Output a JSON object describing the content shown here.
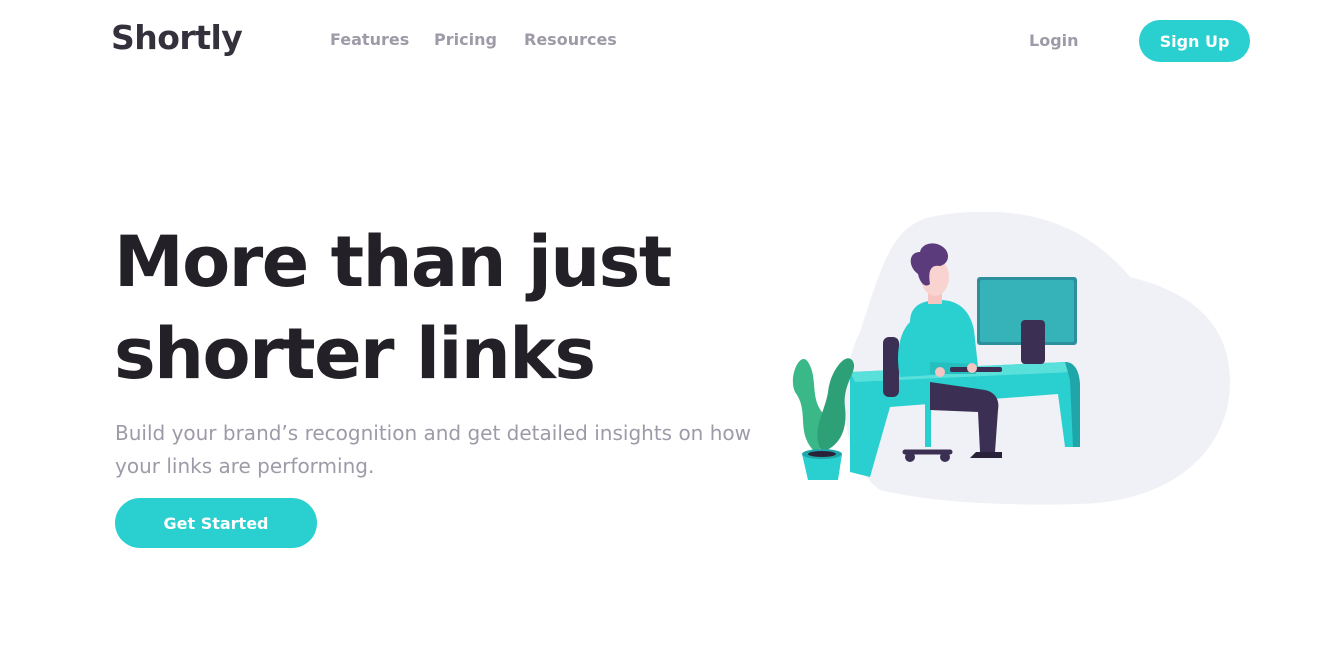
{
  "brand": {
    "logo": "Shortly"
  },
  "nav": {
    "items": [
      {
        "label": "Features"
      },
      {
        "label": "Pricing"
      },
      {
        "label": "Resources"
      }
    ],
    "login": "Login",
    "signup": "Sign Up"
  },
  "hero": {
    "title_line1": "More than just",
    "title_line2": "shorter links",
    "subtitle": "Build your brand’s recognition and get detailed insights on how your links are performing.",
    "cta": "Get Started"
  },
  "colors": {
    "primary": "#2acfcf",
    "heading": "#232127",
    "muted": "#9e9aa7",
    "blob": "#f0f1f6",
    "plant": "#3bb887"
  },
  "illustration": {
    "name": "person-working-at-desk"
  }
}
